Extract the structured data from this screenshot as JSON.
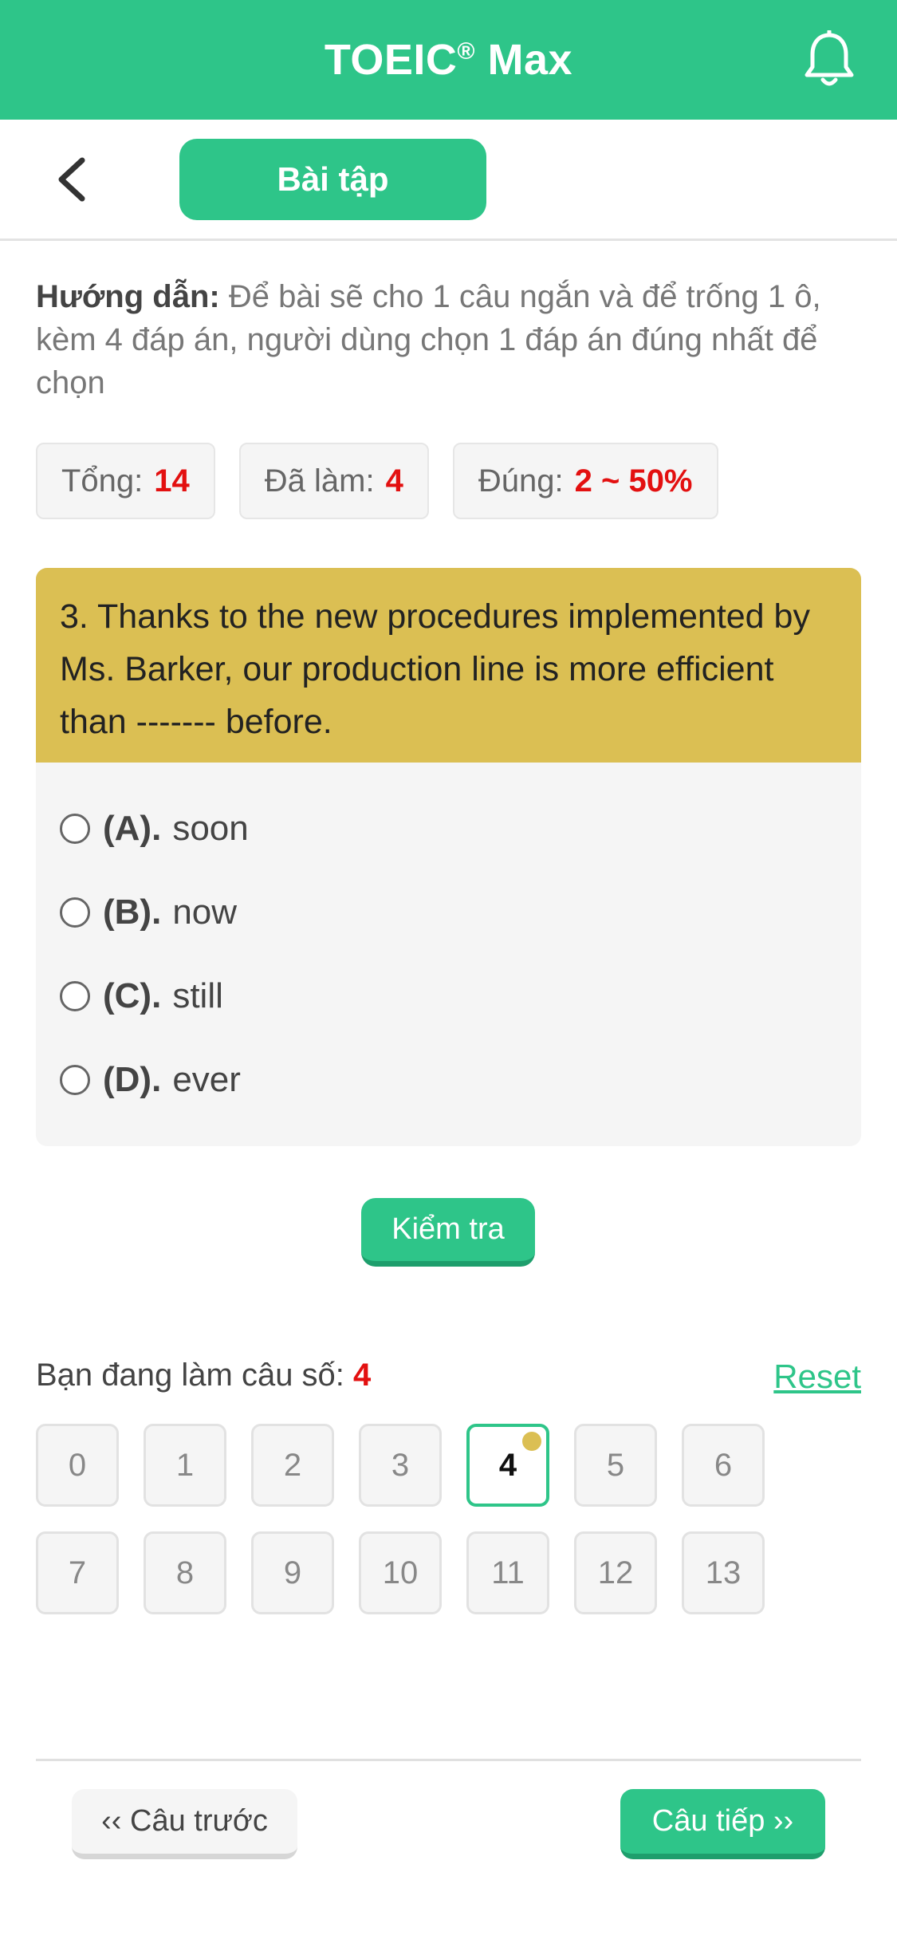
{
  "header": {
    "title": "TOEIC",
    "title_mark": "®",
    "title_suffix": " Max",
    "bell_icon": "bell-icon"
  },
  "subbar": {
    "back_icon": "chevron-left-icon",
    "tab_label": "Bài tập"
  },
  "instruction": {
    "label": "Hướng dẫn:",
    "text": " Để bài sẽ cho 1 câu ngắn và để trống 1 ô, kèm 4 đáp án, người dùng chọn 1 đáp án đúng nhất để chọn"
  },
  "stats": {
    "total_label": "Tổng:",
    "total_value": "14",
    "done_label": "Đã làm:",
    "done_value": "4",
    "correct_label": "Đúng:",
    "correct_value": "2 ~ 50%"
  },
  "question": {
    "text": "3. Thanks to the new procedures implemented by Ms. Barker, our production line is more efficient than ------- before.",
    "options": [
      {
        "key": "(A).",
        "text": "soon"
      },
      {
        "key": "(B).",
        "text": "now"
      },
      {
        "key": "(C).",
        "text": "still"
      },
      {
        "key": "(D).",
        "text": "ever"
      }
    ]
  },
  "check_button": "Kiểm tra",
  "progress": {
    "label": "Bạn đang làm câu số:",
    "current": "4",
    "reset": "Reset",
    "numbers": [
      "0",
      "1",
      "2",
      "3",
      "4",
      "5",
      "6",
      "7",
      "8",
      "9",
      "10",
      "11",
      "12",
      "13"
    ]
  },
  "footer": {
    "prev": "‹‹ Câu trước",
    "next": "Câu tiếp ››"
  },
  "colors": {
    "brand_green": "#2ec589",
    "highlight_yellow": "#dbbf53",
    "accent_red": "#e31010"
  }
}
